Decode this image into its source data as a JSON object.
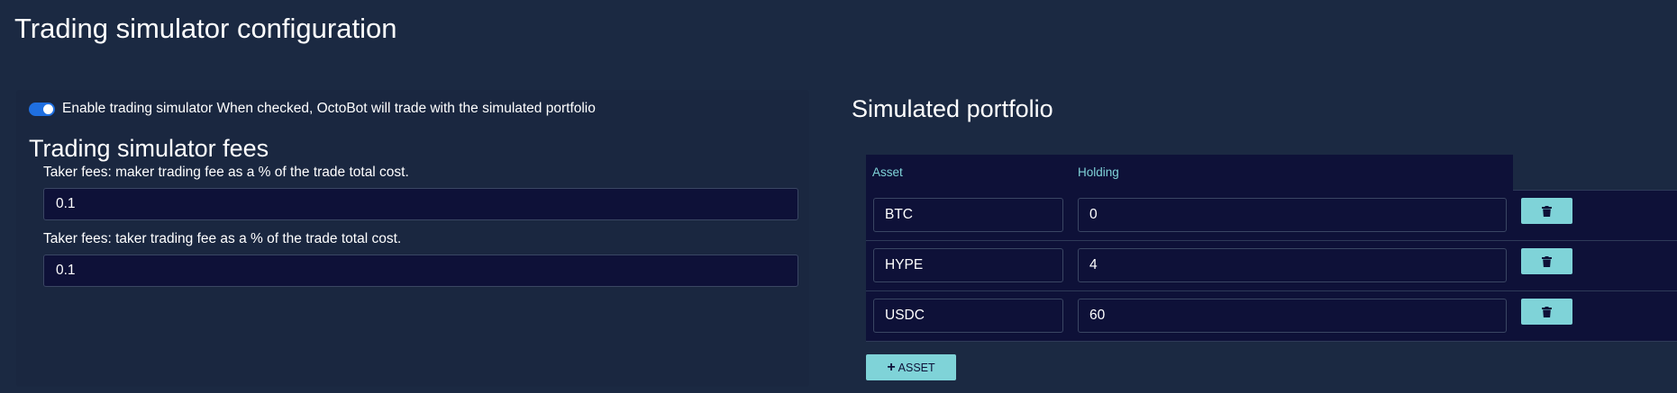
{
  "page": {
    "title": "Trading simulator configuration"
  },
  "simulator": {
    "toggle_enabled": true,
    "toggle_label": "Enable trading simulator When checked, OctoBot will trade with the simulated portfolio"
  },
  "fees": {
    "title": "Trading simulator fees",
    "maker_label": "Taker fees: maker trading fee as a % of the trade total cost.",
    "maker_value": "0.1",
    "taker_label": "Taker fees: taker trading fee as a % of the trade total cost.",
    "taker_value": "0.1"
  },
  "portfolio": {
    "title": "Simulated portfolio",
    "columns": [
      "Asset",
      "Holding"
    ],
    "rows": [
      {
        "asset": "BTC",
        "holding": "0"
      },
      {
        "asset": "HYPE",
        "holding": "4"
      },
      {
        "asset": "USDC",
        "holding": "60"
      }
    ],
    "delete_icon": "trash-icon",
    "add_button_label": "ASSET",
    "add_icon": "plus-icon"
  },
  "colors": {
    "background": "#1b2942",
    "input_bg": "#0e1138",
    "accent": "#7fd3d8",
    "toggle": "#1f6fe0"
  }
}
